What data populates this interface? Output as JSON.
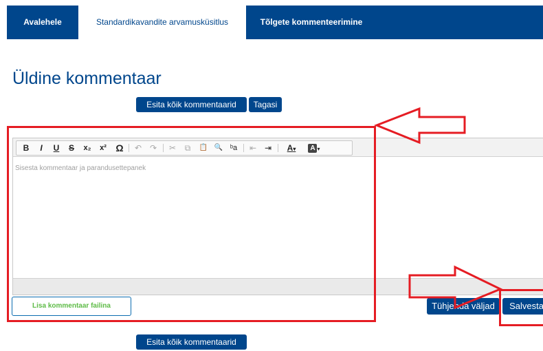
{
  "nav": {
    "tabs": [
      {
        "label": "Avalehele"
      },
      {
        "label": "Standardikavandite arvamusküsitlus"
      },
      {
        "label": "Tõlgete kommenteerimine"
      }
    ]
  },
  "page": {
    "title": "Üldine kommentaar"
  },
  "actions": {
    "submit_all": "Esita kõik kommentaarid",
    "back": "Tagasi",
    "clear": "Tühjenda väljad",
    "save": "Salvesta",
    "submit_all_bottom": "Esita kõik kommentaarid"
  },
  "editor": {
    "placeholder": "Sisesta kommentaar ja parandusettepanek",
    "toolbar": [
      {
        "label": "B",
        "icon": "bold-icon"
      },
      {
        "label": "I",
        "icon": "italic-icon"
      },
      {
        "label": "U",
        "icon": "underline-icon"
      },
      {
        "label": "S",
        "icon": "strikethrough-icon"
      },
      {
        "label": "x₂",
        "icon": "subscript-icon"
      },
      {
        "label": "x²",
        "icon": "superscript-icon"
      },
      {
        "label": "Ω",
        "icon": "special-character-icon"
      },
      {
        "label": "↶",
        "icon": "undo-icon"
      },
      {
        "label": "↷",
        "icon": "redo-icon"
      },
      {
        "label": "✂",
        "icon": "cut-icon"
      },
      {
        "label": "⧉",
        "icon": "copy-icon"
      },
      {
        "label": "📋",
        "icon": "paste-icon"
      },
      {
        "label": "🔍",
        "icon": "find-icon"
      },
      {
        "label": "ᵇa",
        "icon": "replace-icon"
      },
      {
        "label": "⇤",
        "icon": "outdent-icon"
      },
      {
        "label": "⇥",
        "icon": "indent-icon"
      },
      {
        "label": "A",
        "icon": "text-color-icon"
      },
      {
        "label": "A",
        "icon": "background-color-icon"
      }
    ]
  },
  "attach": {
    "label": "Lisa kommentaar failina"
  },
  "colors": {
    "brand": "#00468c",
    "annotation": "#e51c23",
    "attach_text": "#5dbb46"
  }
}
